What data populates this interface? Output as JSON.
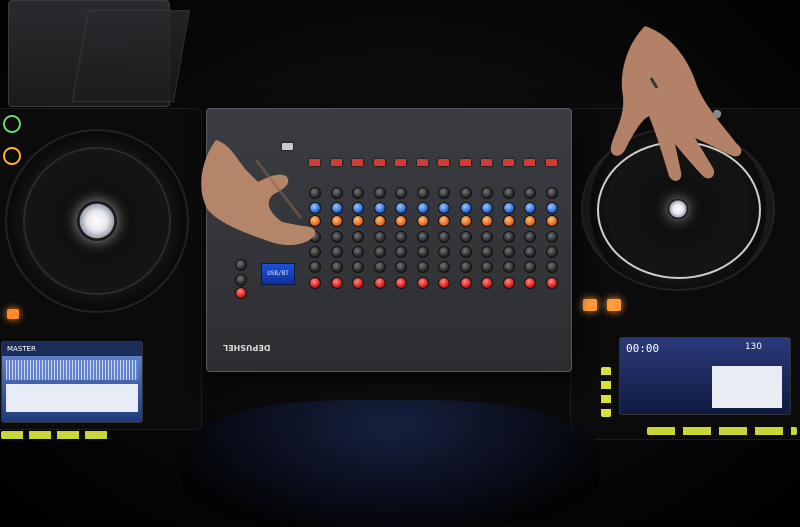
{
  "scene": {
    "description_free": true,
    "colors": {
      "background": "#000000",
      "mixer_body": "#34363b",
      "fader_cap": "#d43b32",
      "knob_blue": "#2c6fd6",
      "knob_orange": "#e0681c",
      "knob_red": "#d21f1f",
      "lcd": "#1e4fd8",
      "screen_glow": "#2a6cff"
    }
  },
  "mixer": {
    "brand_label": "DEPUSHEL",
    "lcd_text": "USB/BT",
    "channel_count": 12
  },
  "left_deck": {
    "screen_text": "MASTER"
  },
  "right_deck": {
    "screen_text": "00:00",
    "screen_bpm": "130"
  },
  "icons": {
    "left_platter": "jog-wheel-icon",
    "right_platter": "jog-wheel-icon"
  }
}
